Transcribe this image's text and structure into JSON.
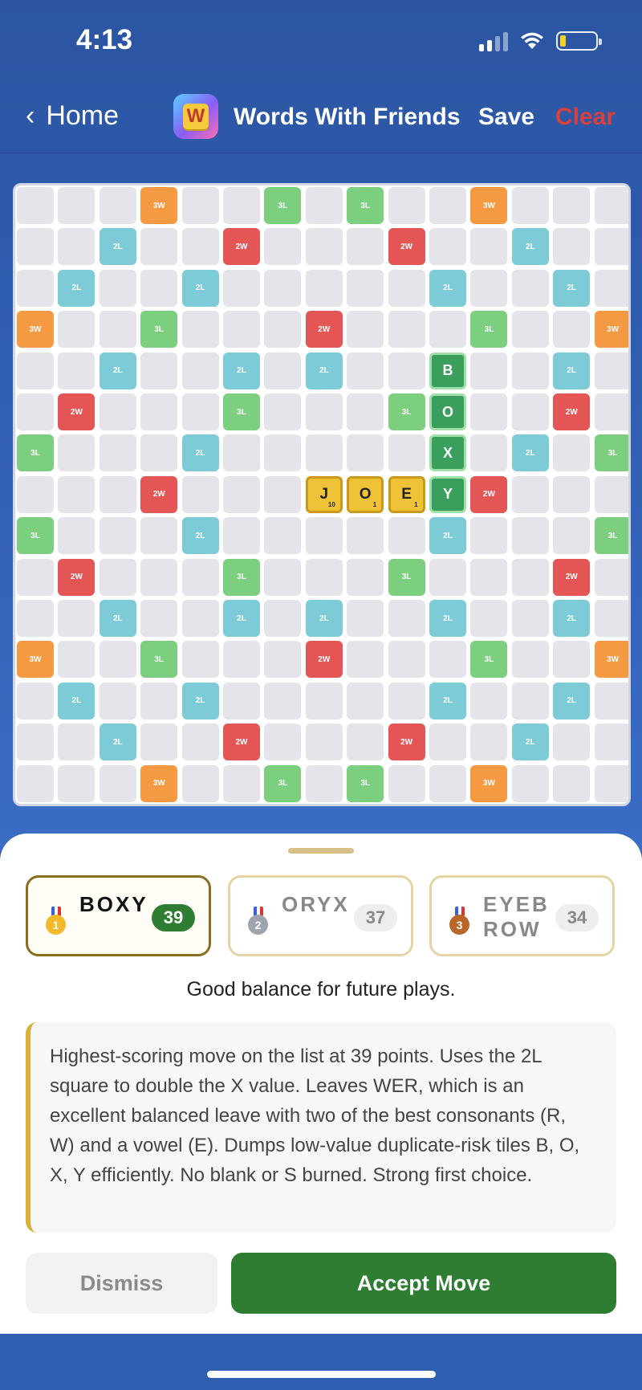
{
  "status_bar": {
    "time": "4:13"
  },
  "nav": {
    "back_label": "Home",
    "back_chevron": "‹",
    "app_logo_letter": "W",
    "title": "Words With Friends",
    "save_label": "Save",
    "clear_label": "Clear"
  },
  "board": {
    "size": 15,
    "premiums": [
      "...T..t.t..T...",
      "..d..D...D..d..",
      ".d..d.....d..d.",
      "T..t...D...t..T",
      "..d..d.d..d..d.",
      ".D...t...t...D.",
      "t...d.......d.t",
      "...D.......D...",
      "t...d.....d...t",
      ".D...t...t...D.",
      "..d..d.d..d..d.",
      "T..t...D...t..T",
      ".d..d.....d..d.",
      "..d..D...D..d..",
      "...T..t.t..T..."
    ],
    "premium_labels": {
      "T": "3W",
      "D": "2W",
      "t": "3L",
      "d": "2L"
    },
    "placed_tiles": [
      {
        "row": 7,
        "col": 7,
        "letter": "J",
        "points": "10"
      },
      {
        "row": 7,
        "col": 8,
        "letter": "O",
        "points": "1"
      },
      {
        "row": 7,
        "col": 9,
        "letter": "E",
        "points": "1"
      }
    ],
    "suggested_tiles": [
      {
        "row": 4,
        "col": 10,
        "letter": "B"
      },
      {
        "row": 5,
        "col": 10,
        "letter": "O"
      },
      {
        "row": 6,
        "col": 10,
        "letter": "X"
      },
      {
        "row": 7,
        "col": 10,
        "letter": "Y"
      }
    ]
  },
  "suggestions": [
    {
      "word": "BOXY",
      "score": "39",
      "rank": "1",
      "selected": true
    },
    {
      "word": "ORYX",
      "score": "37",
      "rank": "2",
      "selected": false
    },
    {
      "word": "EYEBROW",
      "score": "34",
      "rank": "3",
      "selected": false
    }
  ],
  "summary": "Good balance for future plays.",
  "explanation": "Highest-scoring move on the list at 39 points. Uses the 2L square to double the X value. Leaves WER, which is an excellent balanced leave with two of the best consonants (R, W) and a vowel (E). Dumps low-value duplicate-risk tiles B, O, X, Y efficiently. No blank or S burned. Strong first choice.",
  "actions": {
    "dismiss_label": "Dismiss",
    "accept_label": "Accept Move"
  },
  "colors": {
    "accent_green": "#2e7d32",
    "nav_blue": "#2f5fb0",
    "clear_red": "#d8413b",
    "tile_yellow": "#efc237"
  }
}
